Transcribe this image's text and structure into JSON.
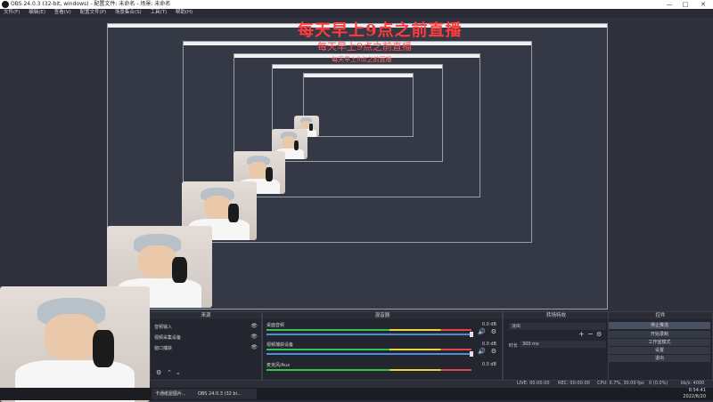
{
  "window": {
    "title": "OBS 24.0.3 (32-bit, windows) - 配置文件: 未命名 - 场景: 未命名"
  },
  "menu": [
    "文件(F)",
    "编辑(E)",
    "查看(V)",
    "配置文件(P)",
    "场景集合(S)",
    "工具(T)",
    "帮助(H)"
  ],
  "overlay": {
    "line1": "每天早上9点之前直播",
    "line2": "每天早上9点之前直播",
    "line3": "每天早上9点之前直播"
  },
  "panels": {
    "sources_title": "来源",
    "mixer_title": "混音器",
    "transition_title": "转场特效",
    "controls_title": "控件"
  },
  "sources": [
    "音频输入",
    "视频采集设备",
    "窗口捕获"
  ],
  "mixer": [
    {
      "name": "桌面音频",
      "value": "0.0 dB"
    },
    {
      "name": "视频捕获设备",
      "value": "0.0 dB"
    },
    {
      "name": "麦克风/Aux",
      "value": "0.0 dB"
    }
  ],
  "transition": {
    "type": "淡出",
    "duration_label": "时长",
    "duration_value": "300 ms"
  },
  "controls": [
    "停止推流",
    "开始录制",
    "工作室模式",
    "设置",
    "退出"
  ],
  "status": {
    "live": "LIVE: 00:00:00",
    "rec": "REC: 00:00:00",
    "cpu": "CPU: 0.7%, 30.00 fps",
    "frames": "0 (0.0%)",
    "kbps": "kb/s: 4000"
  },
  "taskbar": {
    "items": [
      "卡通纸屋图片...",
      "OBS 24.0.3 (32 bi..."
    ],
    "time": "8:54:41",
    "date": "2022/6/20"
  }
}
